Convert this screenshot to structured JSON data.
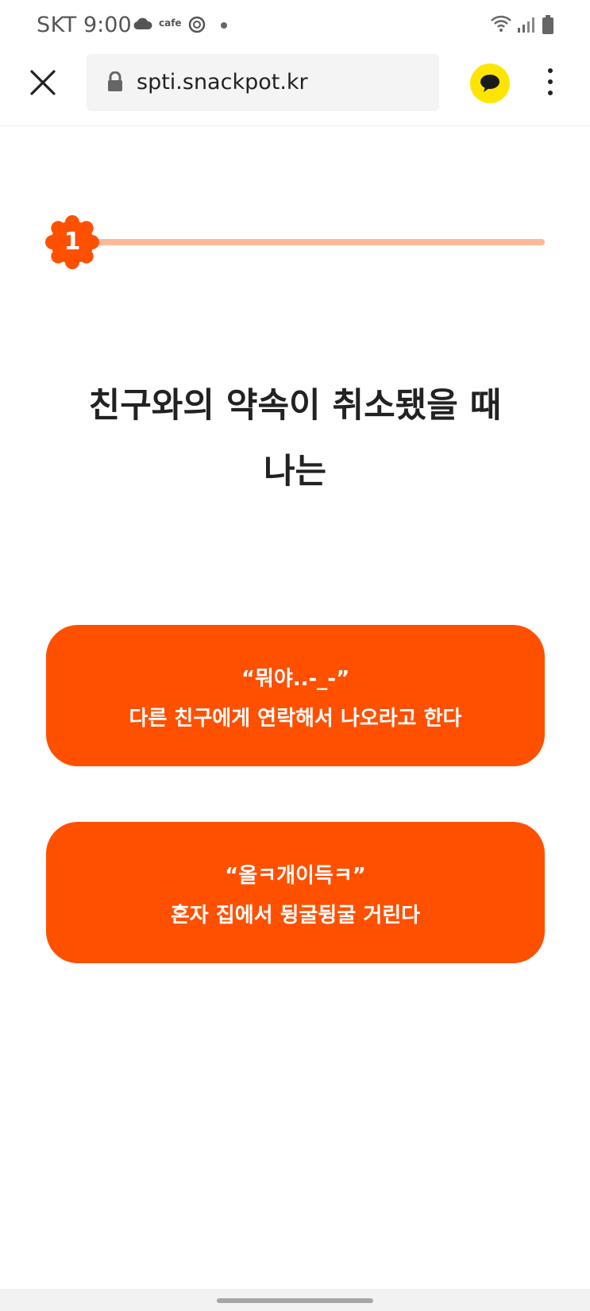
{
  "status_bar": {
    "carrier": "SKT",
    "time": "9:00",
    "cafe_label": "cafe",
    "icons": [
      "cloud-icon",
      "cafe-icon",
      "ball-icon",
      "dot-icon",
      "wifi-icon",
      "signal-icon",
      "battery-icon"
    ]
  },
  "browser": {
    "url": "spti.snackpot.kr",
    "icons": [
      "close-icon",
      "lock-icon",
      "kakaotalk-icon",
      "more-vert-icon"
    ]
  },
  "progress": {
    "step": "1",
    "fraction": 0.0
  },
  "question": {
    "line1": "친구와의 약속이 취소됐을 때",
    "line2": "나는"
  },
  "answers": [
    {
      "quote": "“뭐야..-_-”",
      "description": "다른 친구에게 연락해서 나오라고 한다"
    },
    {
      "quote": "“올ㅋ개이득ㅋ”",
      "description": "혼자 집에서 뒹굴뒹굴 거린다"
    }
  ],
  "colors": {
    "accent": "#ff5000",
    "progress_track": "#fbb89a",
    "kakao_yellow": "#fee500",
    "url_bar_bg": "#f4f4f4"
  }
}
